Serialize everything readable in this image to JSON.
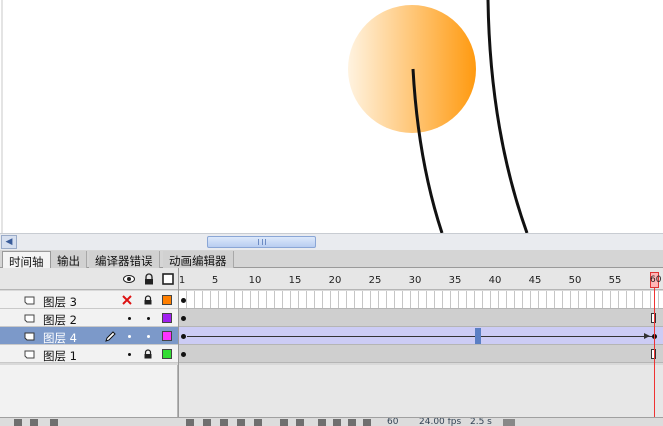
{
  "tabs": [
    {
      "label": "时间轴",
      "active": true
    },
    {
      "label": "输出",
      "active": false
    },
    {
      "label": "编译器错误",
      "active": false
    },
    {
      "label": "动画编辑器",
      "active": false
    }
  ],
  "ruler": {
    "labels": [
      "1",
      "5",
      "10",
      "15",
      "20",
      "25",
      "30",
      "35",
      "40",
      "45",
      "50",
      "55"
    ],
    "current_frame": "60"
  },
  "layers": [
    {
      "name": "图层 3",
      "color": "#ff7f00",
      "visible_icon": "x-icon",
      "locked": true,
      "selected": false
    },
    {
      "name": "图层 2",
      "color": "#a020f0",
      "visible_icon": "dot",
      "locked": false,
      "selected": false
    },
    {
      "name": "图层 4",
      "color": "#ff33ff",
      "visible_icon": "dot",
      "locked": false,
      "selected": true
    },
    {
      "name": "图层 1",
      "color": "#33dd33",
      "visible_icon": "dot",
      "locked": true,
      "selected": false
    }
  ],
  "colors": {
    "sun_light": "#fff3e0",
    "sun_dark": "#ff9a10",
    "selection": "#7c99c9",
    "playhead": "#e33333"
  },
  "status": {
    "frame": "60",
    "fps": "24.00 fps",
    "time": "2.5 s"
  }
}
